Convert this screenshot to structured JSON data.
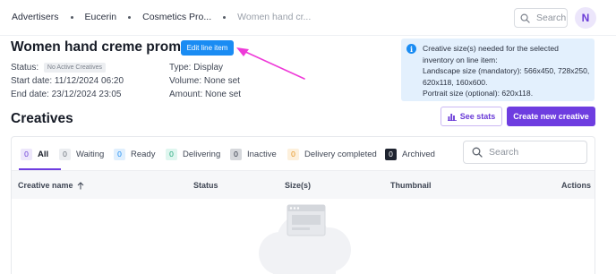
{
  "breadcrumb": [
    "Advertisers",
    "Eucerin",
    "Cosmetics Pro...",
    "Women hand cr..."
  ],
  "top_search": {
    "placeholder": "Search"
  },
  "user": {
    "initial": "N"
  },
  "line_item": {
    "title": "Women hand creme promo",
    "edit_label": "Edit line item",
    "status_label": "Status:",
    "status_badge": "No Active Creatives",
    "start_label": "Start date:",
    "start_value": "11/12/2024 06:20",
    "end_label": "End date:",
    "end_value": "23/12/2024 23:05",
    "type_label": "Type:",
    "type_value": "Display",
    "volume_label": "Volume:",
    "volume_value": "None set",
    "amount_label": "Amount:",
    "amount_value": "None set"
  },
  "info": {
    "line1": "Creative size(s) needed for the selected",
    "line2": "inventory on line item:",
    "line3": "Landscape size (mandatory): 566x450, 728x250,",
    "line4": "620x118, 160x600.",
    "line5": "Portrait size (optional): 620x118."
  },
  "creatives": {
    "title": "Creatives",
    "see_stats": "See stats",
    "create_new": "Create new creative",
    "search_placeholder": "Search",
    "tabs": [
      {
        "count": "0",
        "label": "All",
        "count_bg": "#ede7fb",
        "count_color": "#6a3bd7"
      },
      {
        "count": "0",
        "label": "Waiting",
        "count_bg": "#eceef1",
        "count_color": "#6a707a"
      },
      {
        "count": "0",
        "label": "Ready",
        "count_bg": "#e0effd",
        "count_color": "#1a8cf3"
      },
      {
        "count": "0",
        "label": "Delivering",
        "count_bg": "#dff6ef",
        "count_color": "#20a77a"
      },
      {
        "count": "0",
        "label": "Inactive",
        "count_bg": "#d6d8dc",
        "count_color": "#2b3140"
      },
      {
        "count": "0",
        "label": "Delivery completed",
        "count_bg": "#fdf0dc",
        "count_color": "#e69422"
      },
      {
        "count": "0",
        "label": "Archived",
        "count_bg": "#1f2430",
        "count_color": "#ffffff"
      }
    ],
    "columns": {
      "name": "Creative name",
      "status": "Status",
      "sizes": "Size(s)",
      "thumbnail": "Thumbnail",
      "actions": "Actions"
    }
  },
  "colors": {
    "primary_purple": "#6e3de0",
    "edit_blue": "#1a8cf3",
    "annotation_arrow": "#ee3ad8",
    "info_bg": "#e3f0fd"
  }
}
